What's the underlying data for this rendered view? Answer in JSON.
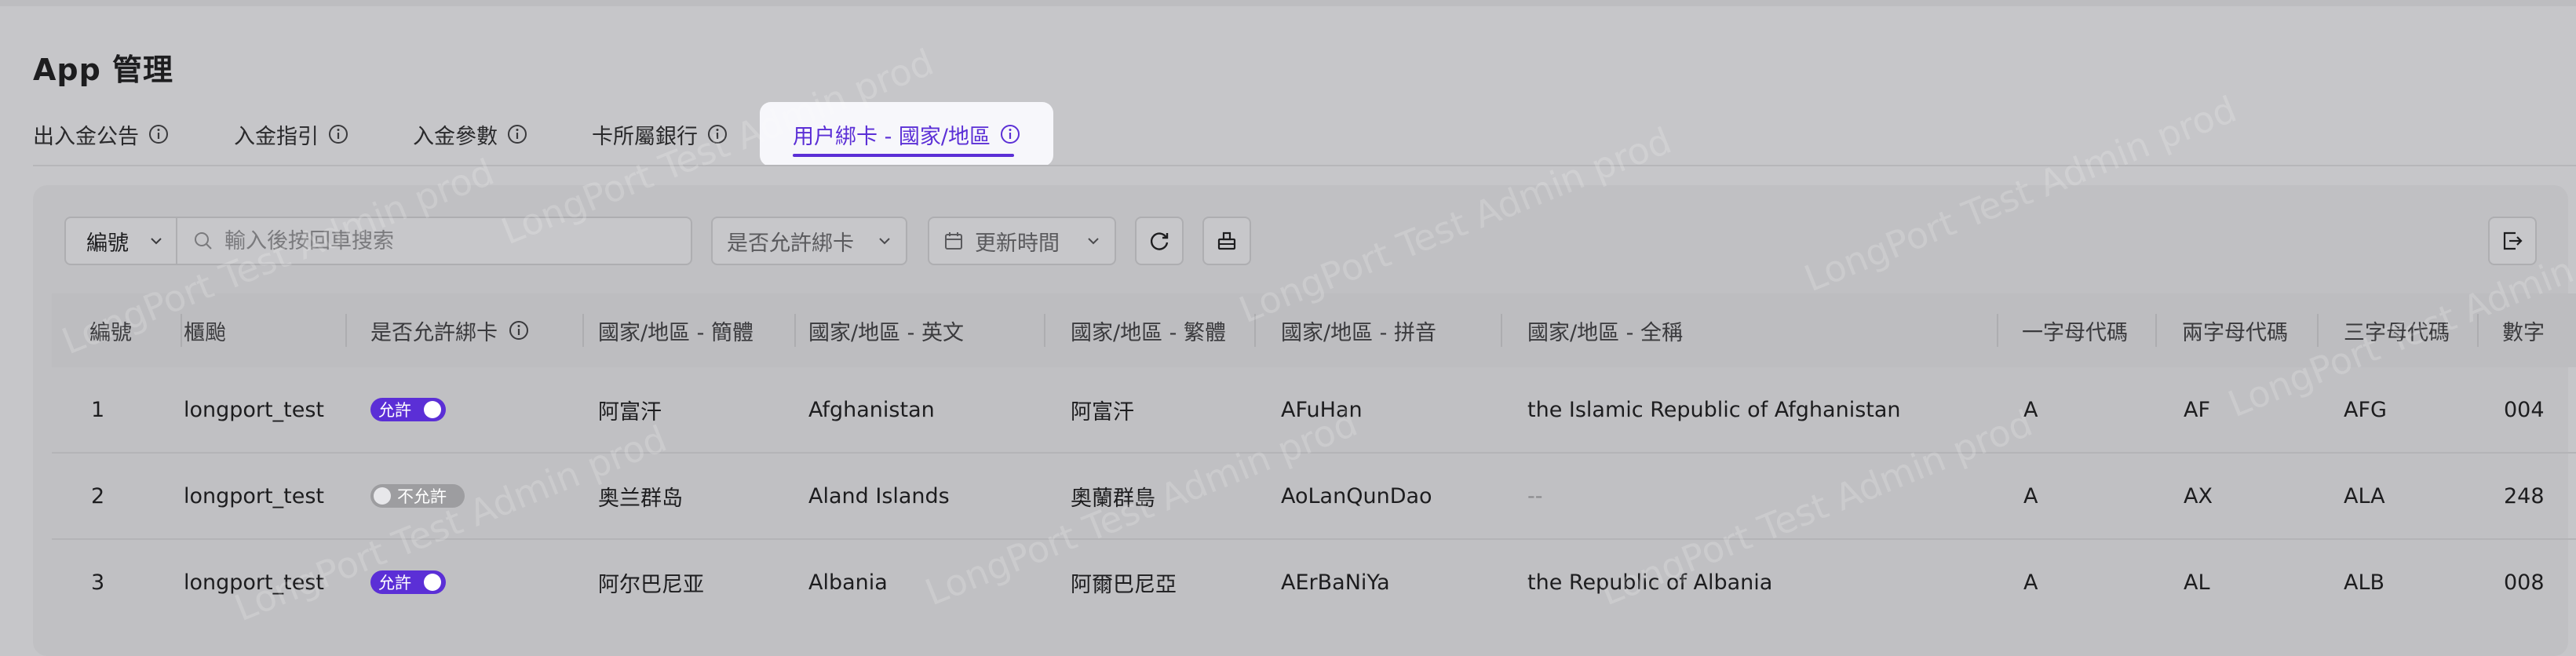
{
  "page": {
    "title": "App 管理"
  },
  "tabs": [
    {
      "label": "出入金公告",
      "active": false
    },
    {
      "label": "入金指引",
      "active": false
    },
    {
      "label": "入金參數",
      "active": false
    },
    {
      "label": "卡所屬銀行",
      "active": false
    },
    {
      "label": "用户綁卡 - 國家/地區",
      "active": true
    }
  ],
  "toolbar": {
    "field_select": "編號",
    "search_placeholder": "輸入後按回車搜索",
    "bind_filter": "是否允許綁卡",
    "time_filter": "更新時間"
  },
  "table": {
    "columns": [
      "編號",
      "櫃颱",
      "是否允許綁卡",
      "國家/地區 - 簡體",
      "國家/地區 - 英文",
      "國家/地區 - 繁體",
      "國家/地區 - 拼音",
      "國家/地區 - 全稱",
      "一字母代碼",
      "兩字母代碼",
      "三字母代碼",
      "數字"
    ],
    "rows": [
      {
        "id": "1",
        "tenant": "longport_test",
        "allow": true,
        "allow_label": "允許",
        "zh_hans": "阿富汗",
        "en": "Afghanistan",
        "zh_hant": "阿富汗",
        "pinyin": "AFuHan",
        "full": "the Islamic Republic of Afghanistan",
        "code1": "A",
        "code2": "AF",
        "code3": "AFG",
        "num": "004"
      },
      {
        "id": "2",
        "tenant": "longport_test",
        "allow": false,
        "allow_label": "不允許",
        "zh_hans": "奥兰群岛",
        "en": "Aland Islands",
        "zh_hant": "奧蘭群島",
        "pinyin": "AoLanQunDao",
        "full": "--",
        "code1": "A",
        "code2": "AX",
        "code3": "ALA",
        "num": "248"
      },
      {
        "id": "3",
        "tenant": "longport_test",
        "allow": true,
        "allow_label": "允許",
        "zh_hans": "阿尔巴尼亚",
        "en": "Albania",
        "zh_hant": "阿爾巴尼亞",
        "pinyin": "AErBaNiYa",
        "full": "the Republic of Albania",
        "code1": "A",
        "code2": "AL",
        "code3": "ALB",
        "num": "008"
      }
    ]
  },
  "watermark": "LongPort Test Admin prod",
  "colors": {
    "accent": "#5b2fd6",
    "overlay": "#c6c6c9"
  }
}
